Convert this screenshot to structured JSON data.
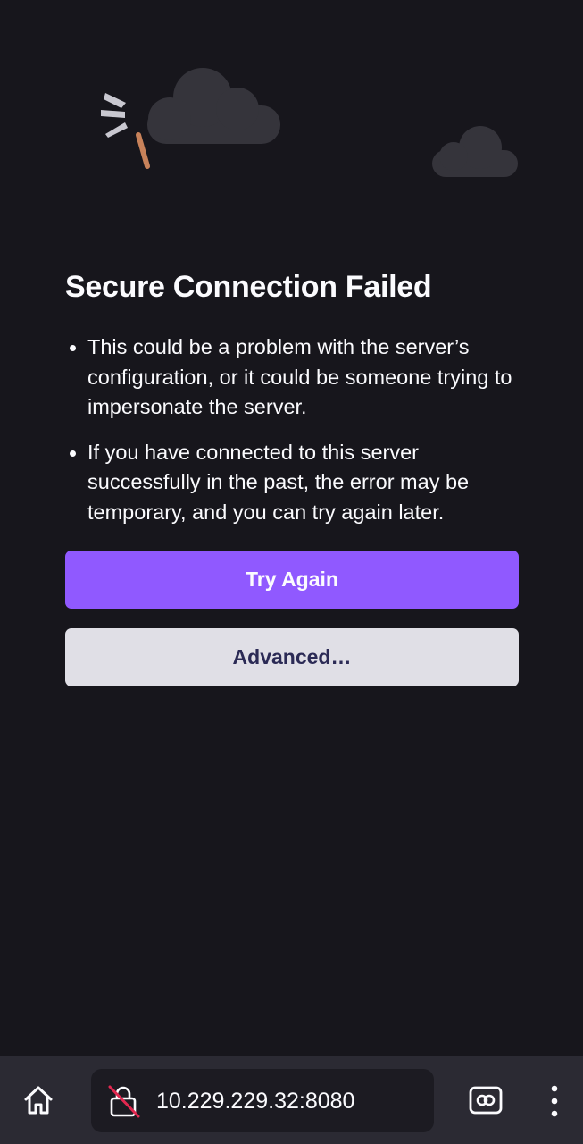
{
  "error_page": {
    "title": "Secure Connection Failed",
    "reasons": [
      "This could be a problem with the server’s configuration, or it could be someone trying to impersonate the server.",
      "If you have connected to this server successfully in the past, the error may be temporary, and you can try again later."
    ],
    "try_again_label": "Try Again",
    "advanced_label": "Advanced…"
  },
  "toolbar": {
    "url": "10.229.229.32:8080",
    "home_icon": "home-icon",
    "lock_icon": "broken-lock-icon",
    "tabs_icon": "tabs-icon",
    "menu_icon": "kebab-menu-icon"
  },
  "colors": {
    "background": "#17161c",
    "accent": "#9059ff",
    "secondary_button": "#e0dfe6",
    "secondary_text": "#2b2a55",
    "toolbar": "#2b2a33",
    "cloud": "#35343b",
    "warning_red": "#e22850"
  }
}
